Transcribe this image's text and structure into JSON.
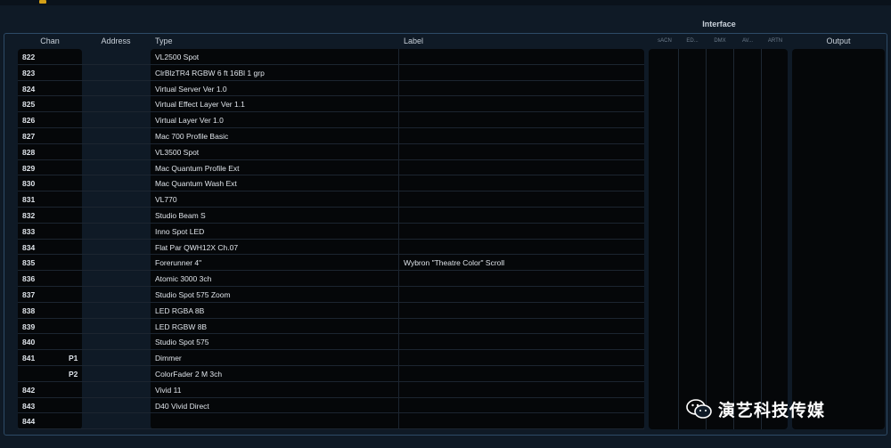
{
  "header": {
    "interface_title": "Interface",
    "chan": "Chan",
    "address": "Address",
    "type": "Type",
    "label": "Label",
    "output": "Output",
    "interface_cols": [
      "sACN",
      "ED...",
      "DMX",
      "AV...",
      "ARTN"
    ]
  },
  "rows": [
    {
      "chan": "822",
      "part": "",
      "type": "VL2500 Spot",
      "label": ""
    },
    {
      "chan": "823",
      "part": "",
      "type": "ClrBlzTR4 RGBW 6 ft 16Bl 1 grp",
      "label": ""
    },
    {
      "chan": "824",
      "part": "",
      "type": "Virtual Server Ver 1.0",
      "label": ""
    },
    {
      "chan": "825",
      "part": "",
      "type": "Virtual Effect Layer Ver 1.1",
      "label": ""
    },
    {
      "chan": "826",
      "part": "",
      "type": "Virtual Layer Ver 1.0",
      "label": ""
    },
    {
      "chan": "827",
      "part": "",
      "type": "Mac 700 Profile Basic",
      "label": ""
    },
    {
      "chan": "828",
      "part": "",
      "type": "VL3500 Spot",
      "label": ""
    },
    {
      "chan": "829",
      "part": "",
      "type": "Mac Quantum Profile Ext",
      "label": ""
    },
    {
      "chan": "830",
      "part": "",
      "type": "Mac Quantum Wash Ext",
      "label": ""
    },
    {
      "chan": "831",
      "part": "",
      "type": "VL770",
      "label": ""
    },
    {
      "chan": "832",
      "part": "",
      "type": "Studio Beam S",
      "label": ""
    },
    {
      "chan": "833",
      "part": "",
      "type": "Inno Spot LED",
      "label": ""
    },
    {
      "chan": "834",
      "part": "",
      "type": "Flat Par QWH12X Ch.07",
      "label": ""
    },
    {
      "chan": "835",
      "part": "",
      "type": "Forerunner 4\"",
      "label": "Wybron \"Theatre Color\" Scroll"
    },
    {
      "chan": "836",
      "part": "",
      "type": "Atomic 3000 3ch",
      "label": ""
    },
    {
      "chan": "837",
      "part": "",
      "type": "Studio Spot 575 Zoom",
      "label": ""
    },
    {
      "chan": "838",
      "part": "",
      "type": "LED RGBA 8B",
      "label": ""
    },
    {
      "chan": "839",
      "part": "",
      "type": "LED RGBW 8B",
      "label": ""
    },
    {
      "chan": "840",
      "part": "",
      "type": "Studio Spot 575",
      "label": ""
    },
    {
      "chan": "841",
      "part": "P1",
      "type": "Dimmer",
      "label": ""
    },
    {
      "chan": "",
      "part": "P2",
      "type": "ColorFader 2 M 3ch",
      "label": ""
    },
    {
      "chan": "842",
      "part": "",
      "type": "Vivid 11",
      "label": ""
    },
    {
      "chan": "843",
      "part": "",
      "type": "D40 Vivid Direct",
      "label": ""
    },
    {
      "chan": "844",
      "part": "",
      "type": "",
      "label": ""
    }
  ],
  "watermark": {
    "icon": "wechat-icon",
    "text": "演艺科技传媒"
  },
  "colors": {
    "background": "#0f1a26",
    "cell": "#050709",
    "border": "#2d4a66",
    "accent": "#d4a017"
  }
}
